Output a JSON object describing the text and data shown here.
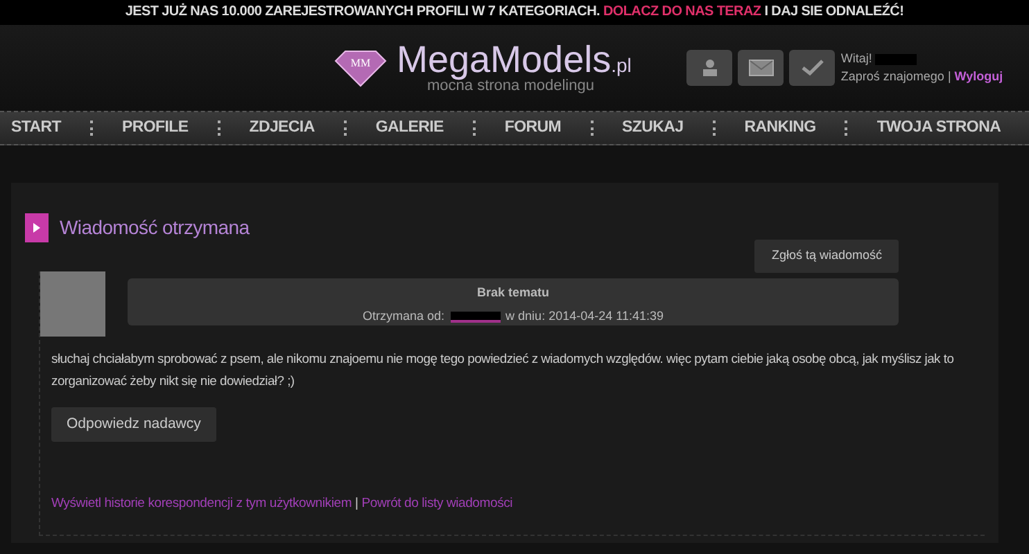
{
  "banner": {
    "text": "JEST JUŻ NAS 10.000 ZAREJESTROWANYCH PROFILI  W 7 KATEGORIACH.",
    "link": "DOLACZ DO NAS TERAZ",
    "after": "I DAJ SIE ODNALEŹĆ!"
  },
  "logo": {
    "mark": "MM",
    "name": "MegaModels",
    "suffix": ".pl",
    "tagline": "mocna strona modelingu"
  },
  "user": {
    "greeting": "Witaj!",
    "invite": "Zaproś znajomego",
    "separator": "|",
    "logout": "Wyloguj"
  },
  "nav": [
    "START",
    "PROFILE",
    "ZDJECIA",
    "GALERIE",
    "FORUM",
    "SZUKAJ",
    "RANKING",
    "TWOJA STRONA"
  ],
  "page": {
    "title": "Wiadomość otrzymana",
    "report_button": "Zgłoś tą wiadomość",
    "message": {
      "subject": "Brak tematu",
      "received_label": "Otrzymana od:",
      "date": "w dniu: 2014-04-24 11:41:39",
      "body": "słuchaj chciałabym sprobować z psem, ale nikomu znajoemu nie mogę tego powiedzieć z wiadomych względów. więc pytam ciebie jaką osobę obcą, jak myślisz jak to zorganizować żeby nikt się nie dowiedział? ;)"
    },
    "reply_button": "Odpowiedz nadawcy",
    "history_link": "Wyświetl historie korespondencji z tym użytkownikiem",
    "link_separator": "|",
    "back_link": "Powrót do listy wiadomości"
  }
}
